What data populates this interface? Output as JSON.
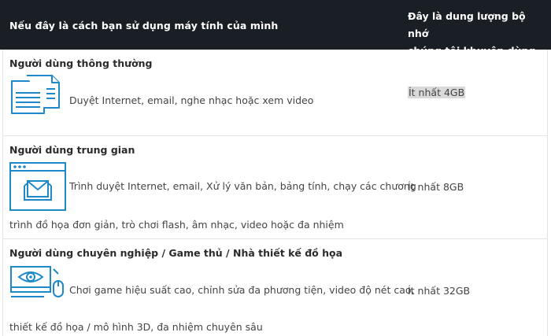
{
  "header": {
    "left": "Nếu đây là cách bạn sử dụng máy tính của mình",
    "right_line1": "Đây là dung lượng bộ nhớ",
    "right_line2": "chúng tôi khuyên dùng"
  },
  "rows": [
    {
      "title": "Người dùng thông thường",
      "icon": "documents-icon",
      "desc_line1": "Duyệt Internet, email, nghe nhạc hoặc xem video",
      "desc_line2": "",
      "memory": "Ít nhất 4GB"
    },
    {
      "title": "Người dùng trung gian",
      "icon": "browser-email-icon",
      "desc_line1": "Trình duyệt Internet, email, Xử lý văn bản, bảng tính, chạy các chương",
      "desc_line2": "trình đồ họa đơn giản, trò chơi flash, âm nhạc, video hoặc đa nhiệm",
      "memory": "Ít nhất 8GB"
    },
    {
      "title": "Người dùng chuyên nghiệp / Game thủ / Nhà thiết kế đồ họa",
      "icon": "monitor-eye-icon",
      "desc_line1": "Chơi game hiệu suất cao, chỉnh sửa đa phương tiện, video độ nét cao,",
      "desc_line2": "thiết kế đồ họa / mô hình 3D, đa nhiệm chuyên sâu",
      "memory": "Ít nhất 32GB"
    }
  ],
  "colors": {
    "header_bg": "#1a1f26",
    "icon_blue": "#1e88c8",
    "highlight": "#d9d9d9"
  }
}
